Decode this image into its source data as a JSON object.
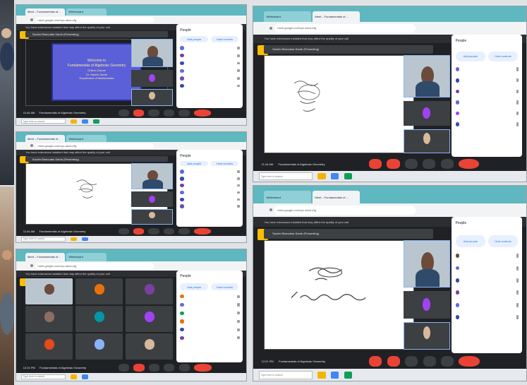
{
  "meeting": {
    "title": "Fundamentals of Algebraic Geometry",
    "time_left": "11:44 AM",
    "time_right_top": "11:44 AM",
    "time_right_bottom": "12:21 PM",
    "time_grid": "12:21 PM"
  },
  "browser": {
    "tab_active": "Meet – Fundamentals of ...",
    "tab_other": "Whiteboard",
    "url": "meet.google.com/xyz-abcd-efg"
  },
  "banner": "You have extensions installed that may affect the quality of your call",
  "presenter_label": "Sachin Bhanudas Sarde (Presenting)",
  "slide": {
    "lines": [
      "Welcome to",
      "Fundamentals of Algebraic Geometry",
      "Online Course",
      "Dr. Sachin Sarde",
      "Department of Mathematics"
    ]
  },
  "people_panel": {
    "title": "People",
    "add_people": "Add people",
    "host_controls": "Host controls"
  },
  "taskbar": {
    "search_placeholder": "Type here to search"
  },
  "grid_participants": [
    "",
    "",
    "",
    "",
    "",
    "",
    "",
    "",
    ""
  ],
  "colors": {
    "meet_dark": "#202124",
    "tab_teal": "#5fb7c0",
    "leave_red": "#ea4335",
    "accent_blue": "#1a73e8",
    "slide_blue": "#5b5fd8"
  }
}
